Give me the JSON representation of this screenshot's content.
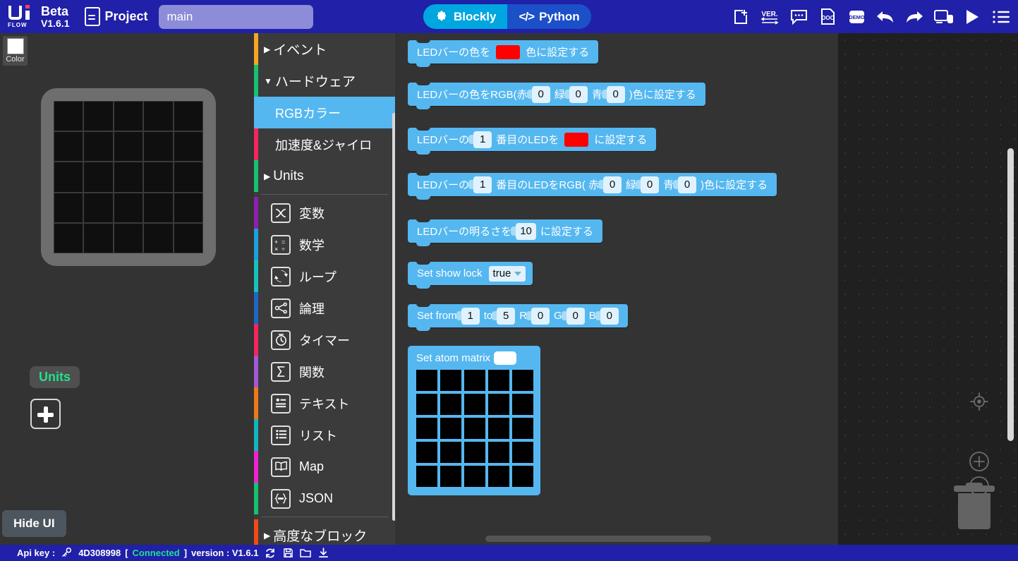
{
  "topbar": {
    "logo_text": "FLOW",
    "beta_label": "Beta",
    "version_label": "V1.6.1",
    "project_label": "Project",
    "project_name": "main",
    "project_placeholder": "main",
    "mode_blockly": "Blockly",
    "mode_python": "Python",
    "active_mode": "Blockly",
    "icons": [
      "new-project-icon",
      "version-icon",
      "comment-icon",
      "doc-icon",
      "demo-icon",
      "undo-icon",
      "redo-icon",
      "device-icon",
      "run-icon",
      "menu-icon"
    ],
    "icon_labels": {
      "version": "VER.",
      "doc": "DOC",
      "demo": "DEMO"
    },
    "accent_blue": "#2020a8",
    "accent_cyan": "#00a6e0"
  },
  "device_panel": {
    "color_tool_label": "Color",
    "color_tool_value": "#ffffff",
    "units_label": "Units",
    "add_unit_label": "+",
    "hide_ui_label": "Hide UI",
    "matrix_rows": 5,
    "matrix_cols": 5,
    "led_color": "#0f0f0f"
  },
  "categories": [
    {
      "label": "イベント",
      "color": "#f5a623",
      "type": "root",
      "expanded": false,
      "selected": false,
      "icon": null
    },
    {
      "label": "ハードウェア",
      "color": "#16c172",
      "type": "root",
      "expanded": true,
      "selected": false,
      "icon": null
    },
    {
      "label": "RGBカラー",
      "color": "#55b7f0",
      "type": "child",
      "expanded": false,
      "selected": true,
      "icon": null
    },
    {
      "label": "加速度&ジャイロ",
      "color": "#f5255e",
      "type": "child",
      "expanded": false,
      "selected": false,
      "icon": null
    },
    {
      "label": "Units",
      "color": "#16c172",
      "type": "root",
      "expanded": false,
      "selected": false,
      "icon": null
    },
    {
      "label": "変数",
      "color": "#8e1fb0",
      "type": "leaf",
      "selected": false,
      "icon": "variables-icon"
    },
    {
      "label": "数学",
      "color": "#1ba1dd",
      "type": "leaf",
      "selected": false,
      "icon": "math-icon"
    },
    {
      "label": "ループ",
      "color": "#15c2b8",
      "type": "leaf",
      "selected": false,
      "icon": "loop-icon"
    },
    {
      "label": "論理",
      "color": "#1f66c6",
      "type": "leaf",
      "selected": false,
      "icon": "logic-icon"
    },
    {
      "label": "タイマー",
      "color": "#f5255e",
      "type": "leaf",
      "selected": false,
      "icon": "timer-icon"
    },
    {
      "label": "関数",
      "color": "#a457d6",
      "type": "leaf",
      "selected": false,
      "icon": "function-icon"
    },
    {
      "label": "テキスト",
      "color": "#f07819",
      "type": "leaf",
      "selected": false,
      "icon": "text-icon"
    },
    {
      "label": "リスト",
      "color": "#13b5bd",
      "type": "leaf",
      "selected": false,
      "icon": "list-icon"
    },
    {
      "label": "Map",
      "color": "#ef23d3",
      "type": "leaf",
      "selected": false,
      "icon": "map-icon"
    },
    {
      "label": "JSON",
      "color": "#16c172",
      "type": "leaf",
      "selected": false,
      "icon": "json-icon"
    },
    {
      "label": "高度なブロック",
      "color": "#f04a18",
      "type": "root",
      "expanded": false,
      "selected": false,
      "icon": null
    }
  ],
  "blocks": [
    {
      "name": "set-led-bar-color-block",
      "parts": [
        {
          "kind": "text",
          "value": "LEDバーの色を"
        },
        {
          "kind": "color",
          "value": "#ff0000"
        },
        {
          "kind": "text",
          "value": "色に設定する"
        }
      ]
    },
    {
      "name": "set-led-bar-color-rgb-block",
      "parts": [
        {
          "kind": "text",
          "value": "LEDバーの色をRGB(赤"
        },
        {
          "kind": "number",
          "value": "0"
        },
        {
          "kind": "text",
          "value": "緑"
        },
        {
          "kind": "number",
          "value": "0"
        },
        {
          "kind": "text",
          "value": "青"
        },
        {
          "kind": "number",
          "value": "0"
        },
        {
          "kind": "text",
          "value": ")色に設定する"
        }
      ]
    },
    {
      "name": "set-nth-led-color-block",
      "parts": [
        {
          "kind": "text",
          "value": "LEDバーの"
        },
        {
          "kind": "number",
          "value": "1"
        },
        {
          "kind": "text",
          "value": "番目のLEDを"
        },
        {
          "kind": "color",
          "value": "#ff0000"
        },
        {
          "kind": "text",
          "value": "に設定する"
        }
      ]
    },
    {
      "name": "set-nth-led-rgb-block",
      "parts": [
        {
          "kind": "text",
          "value": "LEDバーの"
        },
        {
          "kind": "number",
          "value": "1"
        },
        {
          "kind": "text",
          "value": "番目のLEDをRGB( 赤"
        },
        {
          "kind": "number",
          "value": "0"
        },
        {
          "kind": "text",
          "value": "緑"
        },
        {
          "kind": "number",
          "value": "0"
        },
        {
          "kind": "text",
          "value": "青"
        },
        {
          "kind": "number",
          "value": "0"
        },
        {
          "kind": "text",
          "value": ")色に設定する"
        }
      ]
    },
    {
      "name": "set-led-bar-brightness-block",
      "parts": [
        {
          "kind": "text",
          "value": "LEDバーの明るさを"
        },
        {
          "kind": "number",
          "value": "10"
        },
        {
          "kind": "text",
          "value": "に設定する"
        }
      ]
    },
    {
      "name": "set-show-lock-block",
      "parts": [
        {
          "kind": "text",
          "value": "Set show lock"
        },
        {
          "kind": "dropdown",
          "value": "true"
        }
      ]
    },
    {
      "name": "set-range-rgb-block",
      "parts": [
        {
          "kind": "text",
          "value": "Set  from"
        },
        {
          "kind": "number",
          "value": "1"
        },
        {
          "kind": "text",
          "value": "to"
        },
        {
          "kind": "number",
          "value": "5"
        },
        {
          "kind": "text",
          "value": "R"
        },
        {
          "kind": "number",
          "value": "0"
        },
        {
          "kind": "text",
          "value": "G"
        },
        {
          "kind": "number",
          "value": "0"
        },
        {
          "kind": "text",
          "value": "B"
        },
        {
          "kind": "number",
          "value": "0"
        }
      ]
    }
  ],
  "matrix_block": {
    "name": "set-atom-matrix-block",
    "title": "Set atom matrix",
    "color_value": "#ffffff",
    "rows": 5,
    "cols": 5,
    "cell_color": "#000000"
  },
  "workspace": {
    "center_icon": "center-target-icon",
    "zoom_in_icon": "zoom-in-icon",
    "zoom_out_icon": "zoom-out-icon",
    "trash_icon": "trash-icon"
  },
  "statusbar": {
    "api_key_label": "Api key :",
    "api_key_value": "4D308998",
    "bracket_open": "[",
    "connection_status": "Connected",
    "bracket_close": "]",
    "version_text": "version : V1.6.1",
    "icons": [
      "refresh-icon",
      "save-icon",
      "open-folder-icon",
      "download-icon"
    ]
  }
}
